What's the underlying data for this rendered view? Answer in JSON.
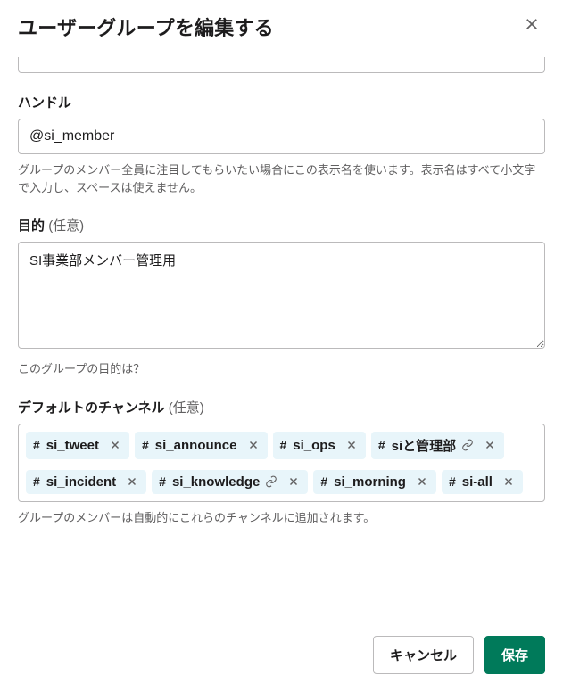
{
  "dialog": {
    "title": "ユーザーグループを編集する",
    "close_aria": "閉じる"
  },
  "handle": {
    "label": "ハンドル",
    "prefix": "@",
    "value": "si_member",
    "help": "グループのメンバー全員に注目してもらいたい場合にこの表示名を使います。表示名はすべて小文字で入力し、スペースは使えません。"
  },
  "purpose": {
    "label": "目的",
    "optional": "(任意)",
    "value": "SI事業部メンバー管理用",
    "help": "このグループの目的は？"
  },
  "channels": {
    "label": "デフォルトのチャンネル",
    "optional": "(任意)",
    "items": [
      {
        "name": "si_tweet",
        "linked": false
      },
      {
        "name": "si_announce",
        "linked": false
      },
      {
        "name": "si_ops",
        "linked": false
      },
      {
        "name": "siと管理部",
        "linked": true
      },
      {
        "name": "si_incident",
        "linked": false
      },
      {
        "name": "si_knowledge",
        "linked": true
      },
      {
        "name": "si_morning",
        "linked": false
      },
      {
        "name": "si-all",
        "linked": false
      }
    ],
    "help": "グループのメンバーは自動的にこれらのチャンネルに追加されます。"
  },
  "footer": {
    "cancel": "キャンセル",
    "save": "保存"
  },
  "icons": {
    "hash": "#"
  }
}
